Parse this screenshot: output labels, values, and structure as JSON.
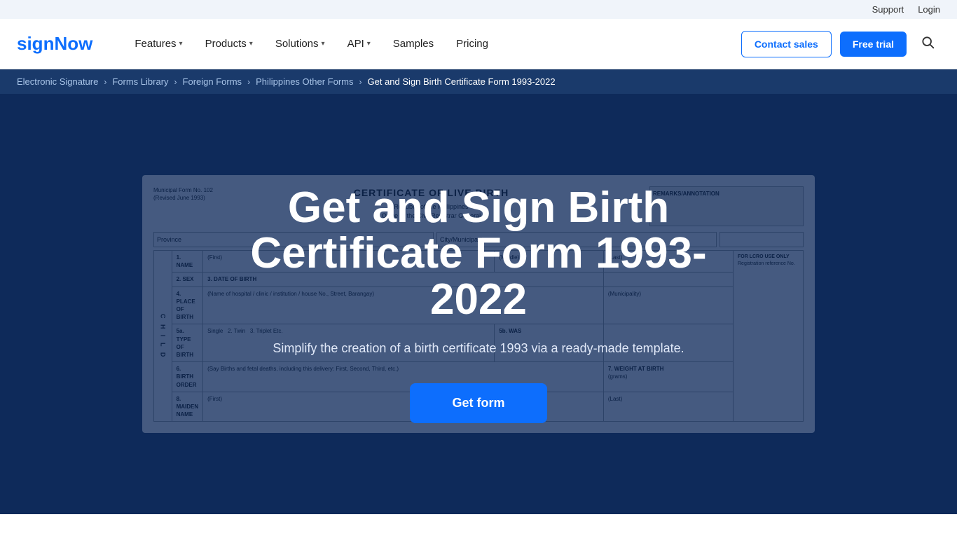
{
  "topbar": {
    "support_label": "Support",
    "login_label": "Login"
  },
  "header": {
    "logo_text": "signNow",
    "nav_items": [
      {
        "label": "Features",
        "has_dropdown": true
      },
      {
        "label": "Products",
        "has_dropdown": true
      },
      {
        "label": "Solutions",
        "has_dropdown": true
      },
      {
        "label": "API",
        "has_dropdown": true
      },
      {
        "label": "Samples",
        "has_dropdown": false
      },
      {
        "label": "Pricing",
        "has_dropdown": false
      }
    ],
    "contact_sales_label": "Contact sales",
    "free_trial_label": "Free trial"
  },
  "breadcrumb": {
    "items": [
      {
        "label": "Electronic Signature",
        "link": true
      },
      {
        "label": "Forms Library",
        "link": true
      },
      {
        "label": "Foreign Forms",
        "link": true
      },
      {
        "label": "Philippines Other Forms",
        "link": true
      },
      {
        "label": "Get and Sign Birth Certificate Form 1993-2022",
        "link": false
      }
    ]
  },
  "hero": {
    "title": "Get and Sign Birth Certificate Form 1993-2022",
    "subtitle": "Simplify the creation of a birth certificate 1993 via a ready-made template.",
    "get_form_label": "Get form"
  },
  "form_bg": {
    "header_left": "Municipal Form No. 102",
    "header_center": "CERTIFICATE OF LIVE BIRTH",
    "remarks_header": "REMARKS/ANNOTATION",
    "province_label": "Province",
    "city_label": "City/Municipality",
    "fields": [
      "1. NAME",
      "2. SEX",
      "3. DATE OF BIRTH",
      "4. PLACE OF BIRTH",
      "5a. TYPE OF BIRTH",
      "5b. WAS",
      "6. BIRTH ORDER",
      "7. WEIGHT AT BIRTH",
      "8. MAIDEN NAME"
    ],
    "name_cols": [
      "(First)",
      "(Middle)",
      "(Last)"
    ],
    "foreign_use": "FOR LCRO USE ONLY",
    "child_label": "C\nH\nI\nL\nD"
  }
}
